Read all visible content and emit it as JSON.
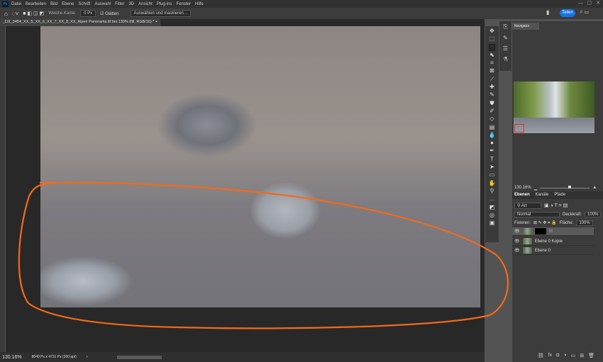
{
  "menubar": {
    "app_icon": "Ps",
    "items": [
      "Datei",
      "Bearbeiten",
      "Bild",
      "Ebene",
      "Schrift",
      "Auswahl",
      "Filter",
      "3D",
      "Ansicht",
      "Plug-ins",
      "Fenster",
      "Hilfe"
    ]
  },
  "options": {
    "feather_label": "Weiche Kante:",
    "feather_value": "0 Px",
    "smooth_label": "Glätten",
    "select_mask": "Auswählen und maskieren..."
  },
  "header": {
    "share": "Teilen"
  },
  "document": {
    "tab_title": "_DX_3454_XX_5_XX_6_XX_7_XX_8_XX_Alpen Panorama.tif bei 130% (fill, RGB/16) *",
    "close": "×"
  },
  "status": {
    "zoom": "130.16%",
    "doc_info": "8049 Px x 4731 Px (300 ppi)",
    "arrow": "›"
  },
  "navigator": {
    "title": "Navigator",
    "zoom": "130.16%"
  },
  "layers": {
    "tabs": [
      "Ebenen",
      "Kanäle",
      "Pfade"
    ],
    "filter": "Art",
    "blend": "Normal",
    "opacity_label": "Deckkraft:",
    "opacity": "100%",
    "lock_label": "Fixieren:",
    "fill_label": "Fläche:",
    "fill": "100%",
    "items": [
      {
        "name": "fill",
        "selected": true
      },
      {
        "name": "Ebene 0 Kopie"
      },
      {
        "name": "Ebene 0"
      }
    ]
  },
  "annotation_color": "#f26a1b"
}
